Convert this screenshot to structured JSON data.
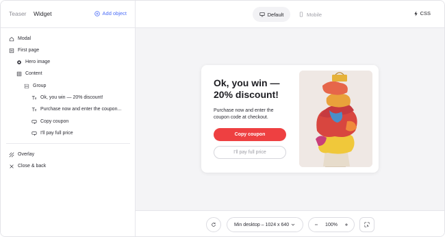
{
  "sidebar": {
    "tabs": {
      "teaser": "Teaser",
      "widget": "Widget"
    },
    "add_object": "Add object",
    "items": [
      {
        "label": "Modal",
        "icon": "home-icon"
      },
      {
        "label": "First page",
        "icon": "page-icon"
      },
      {
        "label": "Hero image",
        "icon": "image-dot-icon"
      },
      {
        "label": "Content",
        "icon": "grid-icon"
      },
      {
        "label": "Group",
        "icon": "group-icon"
      },
      {
        "label": "Ok, you win — 20% discount!",
        "icon": "text-icon"
      },
      {
        "label": "Purchase now and enter the coupon...",
        "icon": "text-icon"
      },
      {
        "label": "Copy coupon",
        "icon": "button-icon"
      },
      {
        "label": "I'll pay full price",
        "icon": "button-icon"
      }
    ],
    "bottom_items": [
      {
        "label": "Overlay",
        "icon": "hatch-icon"
      },
      {
        "label": "Close & back",
        "icon": "close-icon"
      }
    ]
  },
  "topbar": {
    "default_label": "Default",
    "mobile_label": "Mobile",
    "css_label": "CSS"
  },
  "card": {
    "title": "Ok, you win — 20% discount!",
    "body": "Purchase now and enter the coupon code at checkout.",
    "primary_button": "Copy coupon",
    "secondary_button": "I'll pay full price"
  },
  "bottombar": {
    "device": "Min desktop – 1024 x 640",
    "zoom": "100%"
  },
  "colors": {
    "accent": "#4a6cf7",
    "primary_button": "#ee4041",
    "canvas_bg": "#f4f4f6"
  }
}
